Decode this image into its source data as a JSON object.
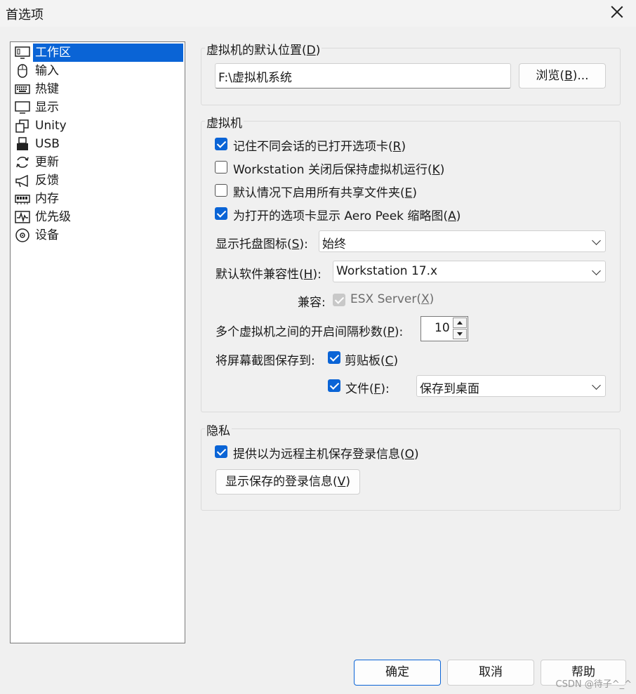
{
  "window": {
    "title": "首选项"
  },
  "sidebar": {
    "items": [
      {
        "label": "工作区",
        "icon": "workspace-monitor-icon",
        "selected": true
      },
      {
        "label": "输入",
        "icon": "mouse-icon"
      },
      {
        "label": "热键",
        "icon": "keyboard-icon"
      },
      {
        "label": "显示",
        "icon": "monitor-icon"
      },
      {
        "label": "Unity",
        "icon": "unity-windows-icon"
      },
      {
        "label": "USB",
        "icon": "usb-icon"
      },
      {
        "label": "更新",
        "icon": "refresh-icon"
      },
      {
        "label": "反馈",
        "icon": "megaphone-icon"
      },
      {
        "label": "内存",
        "icon": "memory-chip-icon"
      },
      {
        "label": "优先级",
        "icon": "priority-pulse-icon"
      },
      {
        "label": "设备",
        "icon": "disc-device-icon"
      }
    ]
  },
  "default_location": {
    "legend": "虚拟机的默认位置(",
    "legend_key": "D",
    "legend_end": ")",
    "path": "F:\\虚拟机系统",
    "browse_label": "浏览(",
    "browse_key": "B",
    "browse_end": ")..."
  },
  "vm": {
    "legend": "虚拟机",
    "remember_tabs": {
      "label": "记住不同会话的已打开选项卡(",
      "key": "R",
      "end": ")",
      "checked": true
    },
    "keep_running": {
      "label": "Workstation 关闭后保持虚拟机运行(",
      "key": "K",
      "end": ")",
      "checked": false
    },
    "share_folders": {
      "label": "默认情况下启用所有共享文件夹(",
      "key": "E",
      "end": ")",
      "checked": false
    },
    "aero_peek": {
      "label": "为打开的选项卡显示 Aero Peek 缩略图(",
      "key": "A",
      "end": ")",
      "checked": true
    },
    "tray_icon": {
      "label": "显示托盘图标(",
      "key": "S",
      "end": "):",
      "value": "始终"
    },
    "compat": {
      "label": "默认软件兼容性(",
      "key": "H",
      "end": "):",
      "value": "Workstation 17.x"
    },
    "compat_with": {
      "label": "兼容:",
      "option": "ESX Server(",
      "key": "X",
      "end": ")",
      "checked": true,
      "disabled": true
    },
    "interval": {
      "label": "多个虚拟机之间的开启间隔秒数(",
      "key": "P",
      "end": "):",
      "value": "10"
    },
    "screenshot": {
      "label": "将屏幕截图保存到:",
      "clipboard": {
        "label": "剪贴板(",
        "key": "C",
        "end": ")",
        "checked": true
      },
      "file": {
        "label": "文件(",
        "key": "F",
        "end": "):",
        "checked": true,
        "value": "保存到桌面"
      }
    }
  },
  "privacy": {
    "legend": "隐私",
    "save_login": {
      "label": "提供以为远程主机保存登录信息(",
      "key": "O",
      "end": ")",
      "checked": true
    },
    "show_login_label": "显示保存的登录信息(",
    "show_login_key": "V",
    "show_login_end": ")"
  },
  "footer": {
    "ok": "确定",
    "cancel": "取消",
    "help": "帮助"
  },
  "watermark": "CSDN @待子^_^",
  "colors": {
    "accent": "#0a64d6",
    "background": "#f0f0f0"
  }
}
